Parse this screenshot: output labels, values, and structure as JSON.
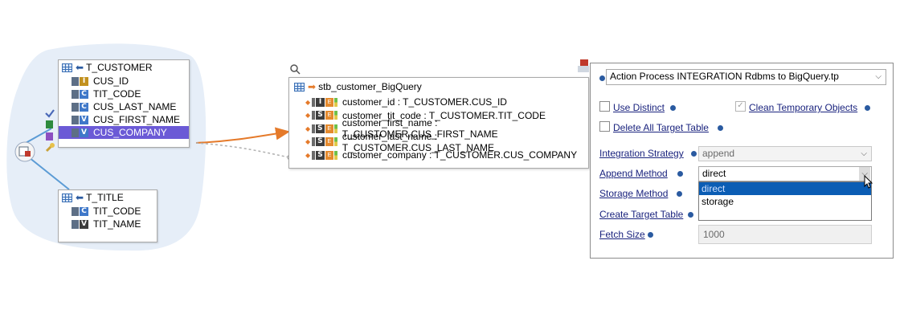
{
  "source_tables": [
    {
      "name": "T_CUSTOMER",
      "columns": [
        {
          "name": "CUS_ID",
          "type_letter": "I",
          "color": "#c2911f",
          "selected": false
        },
        {
          "name": "TIT_CODE",
          "type_letter": "C",
          "color": "#3f78c9",
          "selected": false
        },
        {
          "name": "CUS_LAST_NAME",
          "type_letter": "C",
          "color": "#3f78c9",
          "selected": false
        },
        {
          "name": "CUS_FIRST_NAME",
          "type_letter": "V",
          "color": "#3f78c9",
          "selected": false
        },
        {
          "name": "CUS_COMPANY",
          "type_letter": "V",
          "color": "#3f78c9",
          "selected": true
        }
      ]
    },
    {
      "name": "T_TITLE",
      "columns": [
        {
          "name": "TIT_CODE",
          "type_letter": "C",
          "color": "#3f78c9",
          "selected": false
        },
        {
          "name": "TIT_NAME",
          "type_letter": "V",
          "color": "#3d3d3d",
          "selected": false
        }
      ]
    }
  ],
  "target_table": {
    "name": "stb_customer_BigQuery",
    "columns": [
      {
        "letter": "I",
        "text": "customer_id : T_CUSTOMER.CUS_ID"
      },
      {
        "letter": "S",
        "text": "customer_tit_code : T_CUSTOMER.TIT_CODE"
      },
      {
        "letter": "S",
        "text": "customer_first_name : T_CUSTOMER.CUS_FIRST_NAME"
      },
      {
        "letter": "S",
        "text": "customer_last_name : T_CUSTOMER.CUS_LAST_NAME"
      },
      {
        "letter": "S",
        "text": "customer_company : T_CUSTOMER.CUS_COMPANY"
      }
    ]
  },
  "panel": {
    "process_template": "Action Process INTEGRATION Rdbms to BigQuery.tp",
    "use_distinct_label": "Use Distinct",
    "clean_temp_label": "Clean Temporary Objects",
    "delete_all_label": "Delete All Target Table",
    "integration_strategy_label": "Integration Strategy",
    "integration_strategy_value": "append",
    "append_method_label": "Append Method",
    "append_method_value": "direct",
    "append_method_options": [
      "direct",
      "storage"
    ],
    "storage_method_label": "Storage Method",
    "create_target_label": "Create Target Table",
    "fetch_size_label": "Fetch Size",
    "fetch_size_value": "1000"
  },
  "colors": {
    "canvas_bubble": "#e6eef8",
    "selection": "#6b5ad6",
    "mapping_line": "#e57a2a",
    "dropdown_highlight": "#0b5db4"
  }
}
